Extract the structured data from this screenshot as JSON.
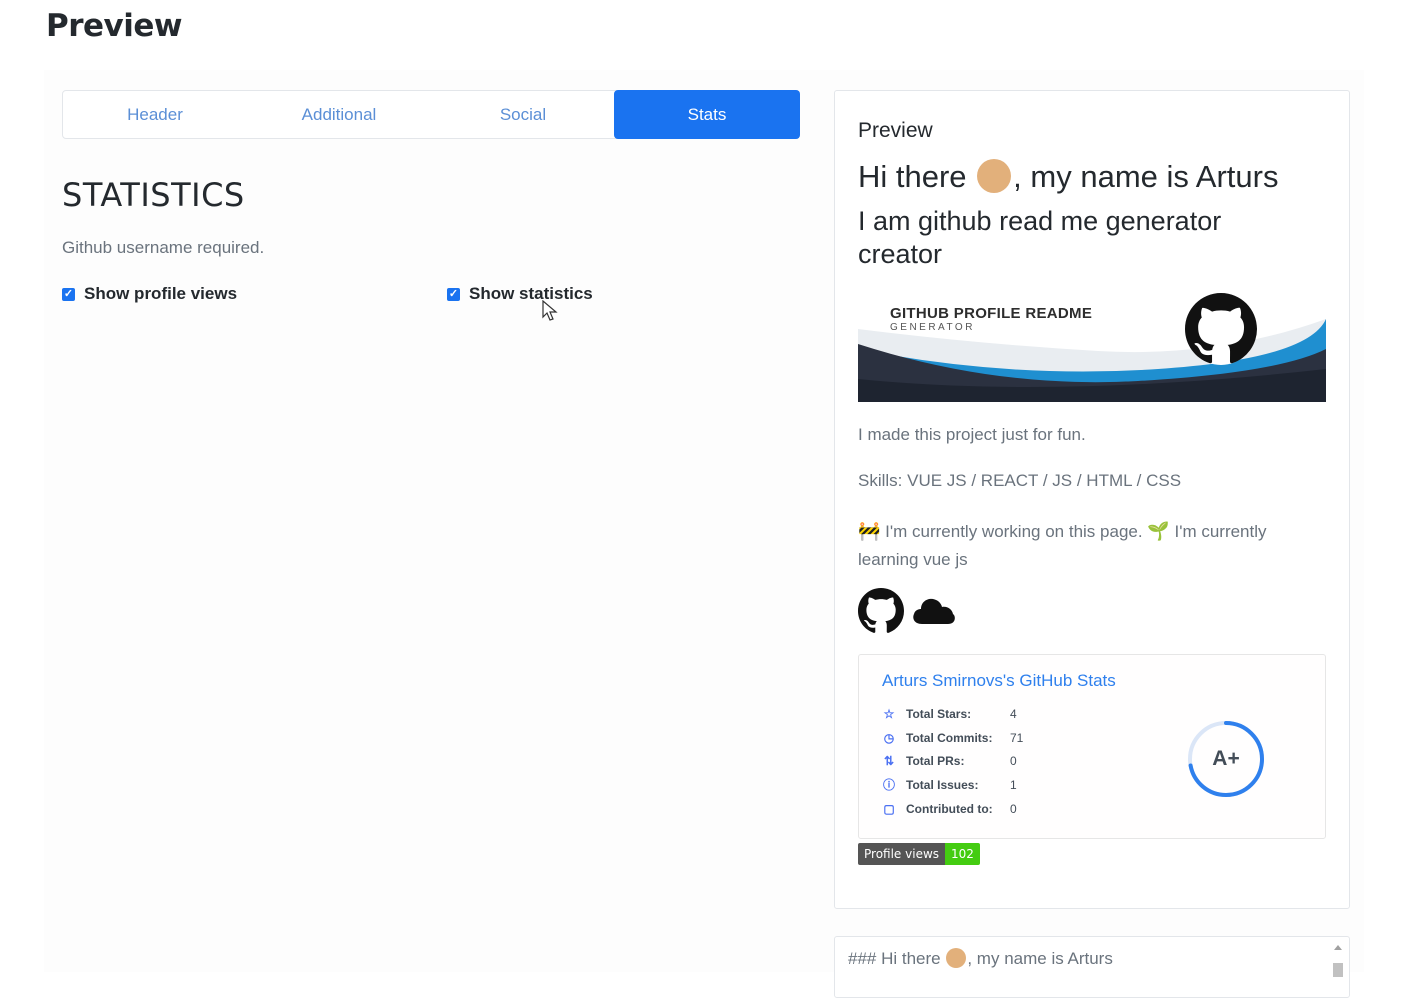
{
  "page": {
    "title": "Preview"
  },
  "tabs": [
    {
      "label": "Header"
    },
    {
      "label": "Additional"
    },
    {
      "label": "Social"
    },
    {
      "label": "Stats",
      "active": true
    }
  ],
  "stats_section": {
    "title": "STATISTICS",
    "hint": "Github username required.",
    "show_profile_views": {
      "label": "Show profile views",
      "checked": true
    },
    "show_statistics": {
      "label": "Show statistics",
      "checked": true
    }
  },
  "preview": {
    "label": "Preview",
    "greeting_before": "Hi there",
    "greeting_after": ", my name is Arturs",
    "subtitle": "I am github read me generator creator",
    "banner": {
      "title": "GITHUB PROFILE README",
      "subtitle": "GENERATOR"
    },
    "about": "I made this project just for fun.",
    "skills": "Skills: VUE JS / REACT / JS / HTML / CSS",
    "working": "I'm currently working on this page.",
    "learning_prefix": "I'm currently",
    "learning_rest": "learning vue js",
    "stats_card": {
      "title": "Arturs Smirnovs's GitHub Stats",
      "rows": [
        {
          "label": "Total Stars:",
          "value": "4",
          "icon": "star-icon"
        },
        {
          "label": "Total Commits:",
          "value": "71",
          "icon": "history-icon"
        },
        {
          "label": "Total PRs:",
          "value": "0",
          "icon": "pull-request-icon"
        },
        {
          "label": "Total Issues:",
          "value": "1",
          "icon": "issue-icon"
        },
        {
          "label": "Contributed to:",
          "value": "0",
          "icon": "repo-icon"
        }
      ],
      "grade": "A+",
      "grade_progress": 0.72
    },
    "badge": {
      "label": "Profile views",
      "value": "102"
    }
  },
  "markdown": {
    "line_before": "### Hi there",
    "line_after": ", my name is Arturs"
  },
  "colors": {
    "accent": "#1a73f0",
    "tab_text": "#5b8fd6",
    "stats_title": "#2f80ed",
    "badge_green": "#44cc11"
  }
}
